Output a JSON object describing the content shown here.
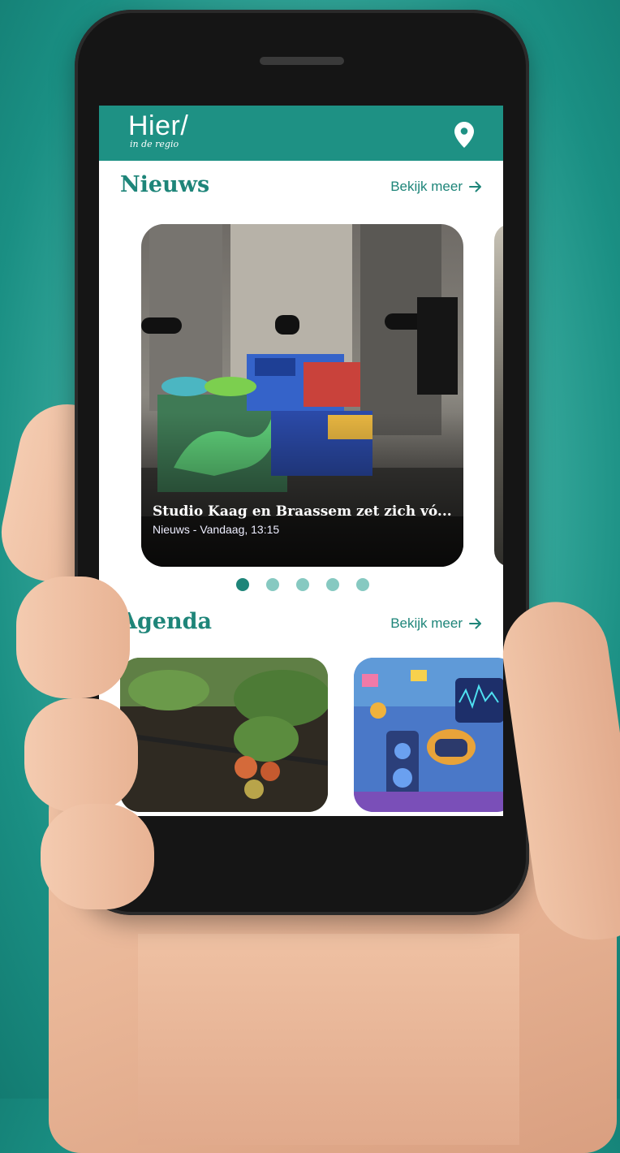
{
  "app": {
    "logo_main": "Hier/",
    "logo_sub": "in de regio"
  },
  "news": {
    "section_title": "Nieuws",
    "see_more": "Bekijk meer",
    "card": {
      "title": "Studio Kaag en Braassem zet zich vó...",
      "meta": "Nieuws - Vandaag, 13:15"
    },
    "pagination_count": 5,
    "active_page": 1
  },
  "agenda": {
    "section_title": "Agenda",
    "see_more": "Bekijk meer"
  },
  "colors": {
    "brand": "#1e9184",
    "brand_text": "#1e8579",
    "dot_inactive": "#86c9c1"
  },
  "icons": {
    "location": "location-pin-icon",
    "arrow": "arrow-right-icon"
  }
}
